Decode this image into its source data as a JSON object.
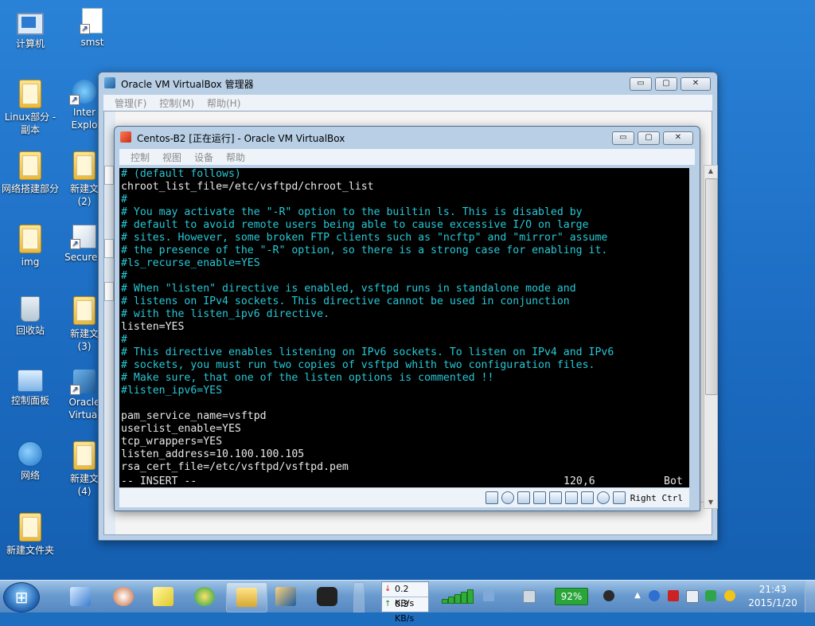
{
  "desktop_icons": [
    {
      "label": "计算机"
    },
    {
      "label": "smst"
    },
    {
      "label": "Linux部分 -\n副本"
    },
    {
      "label": "Inter\nExplo"
    },
    {
      "label": "网络搭建部分"
    },
    {
      "label": "新建文\n(2)"
    },
    {
      "label": "img"
    },
    {
      "label": "SecureC"
    },
    {
      "label": "回收站"
    },
    {
      "label": "新建文\n(3)"
    },
    {
      "label": "控制面板"
    },
    {
      "label": "Oracle\nVirtual"
    },
    {
      "label": "网络"
    },
    {
      "label": "新建文\n(4)"
    },
    {
      "label": "新建文件夹"
    }
  ],
  "manager_window": {
    "title": "Oracle VM VirtualBox 管理器",
    "menu": [
      "管理(F)",
      "控制(M)",
      "帮助(H)"
    ]
  },
  "guest_window": {
    "title": "Centos-B2 [正在运行] - Oracle VM VirtualBox",
    "menu": [
      "控制",
      "视图",
      "设备",
      "帮助"
    ],
    "host_key": "Right Ctrl"
  },
  "caption_buttons": {
    "minimize": "▭",
    "maximize": "▢",
    "close": "✕"
  },
  "terminal": {
    "lines": [
      {
        "text": "# (default follows)",
        "kind": "comment"
      },
      {
        "text": "chroot_list_file=/etc/vsftpd/chroot_list",
        "kind": "setting"
      },
      {
        "text": "#",
        "kind": "comment"
      },
      {
        "text": "# You may activate the \"-R\" option to the builtin ls. This is disabled by",
        "kind": "comment"
      },
      {
        "text": "# default to avoid remote users being able to cause excessive I/O on large",
        "kind": "comment"
      },
      {
        "text": "# sites. However, some broken FTP clients such as \"ncftp\" and \"mirror\" assume",
        "kind": "comment"
      },
      {
        "text": "# the presence of the \"-R\" option, so there is a strong case for enabling it.",
        "kind": "comment"
      },
      {
        "text": "#ls_recurse_enable=YES",
        "kind": "comment"
      },
      {
        "text": "#",
        "kind": "comment"
      },
      {
        "text": "# When \"listen\" directive is enabled, vsftpd runs in standalone mode and",
        "kind": "comment"
      },
      {
        "text": "# listens on IPv4 sockets. This directive cannot be used in conjunction",
        "kind": "comment"
      },
      {
        "text": "# with the listen_ipv6 directive.",
        "kind": "comment"
      },
      {
        "text": "listen=YES",
        "kind": "setting"
      },
      {
        "text": "#",
        "kind": "comment"
      },
      {
        "text": "# This directive enables listening on IPv6 sockets. To listen on IPv4 and IPv6",
        "kind": "comment"
      },
      {
        "text": "# sockets, you must run two copies of vsftpd whith two configuration files.",
        "kind": "comment"
      },
      {
        "text": "# Make sure, that one of the listen options is commented !!",
        "kind": "comment"
      },
      {
        "text": "#listen_ipv6=YES",
        "kind": "comment"
      },
      {
        "text": "",
        "kind": "setting"
      },
      {
        "text": "pam_service_name=vsftpd",
        "kind": "setting"
      },
      {
        "text": "userlist_enable=YES",
        "kind": "setting"
      },
      {
        "text": "tcp_wrappers=YES",
        "kind": "setting"
      },
      {
        "text": "listen_address=10.100.100.105",
        "kind": "setting"
      },
      {
        "text": "rsa_cert_file=/etc/vsftpd/vsftpd.pem",
        "kind": "setting"
      }
    ],
    "mode": "-- INSERT --",
    "position": "120,6",
    "scroll": "Bot",
    "colors": {
      "comment": "#27c8d6",
      "setting": "#e8e8e8",
      "background": "#000000"
    }
  },
  "taskbar": {
    "net_down": "0.2 KB/s",
    "net_up": "0.3 KB/s",
    "battery": "92%",
    "time": "21:43",
    "date": "2015/1/20"
  }
}
